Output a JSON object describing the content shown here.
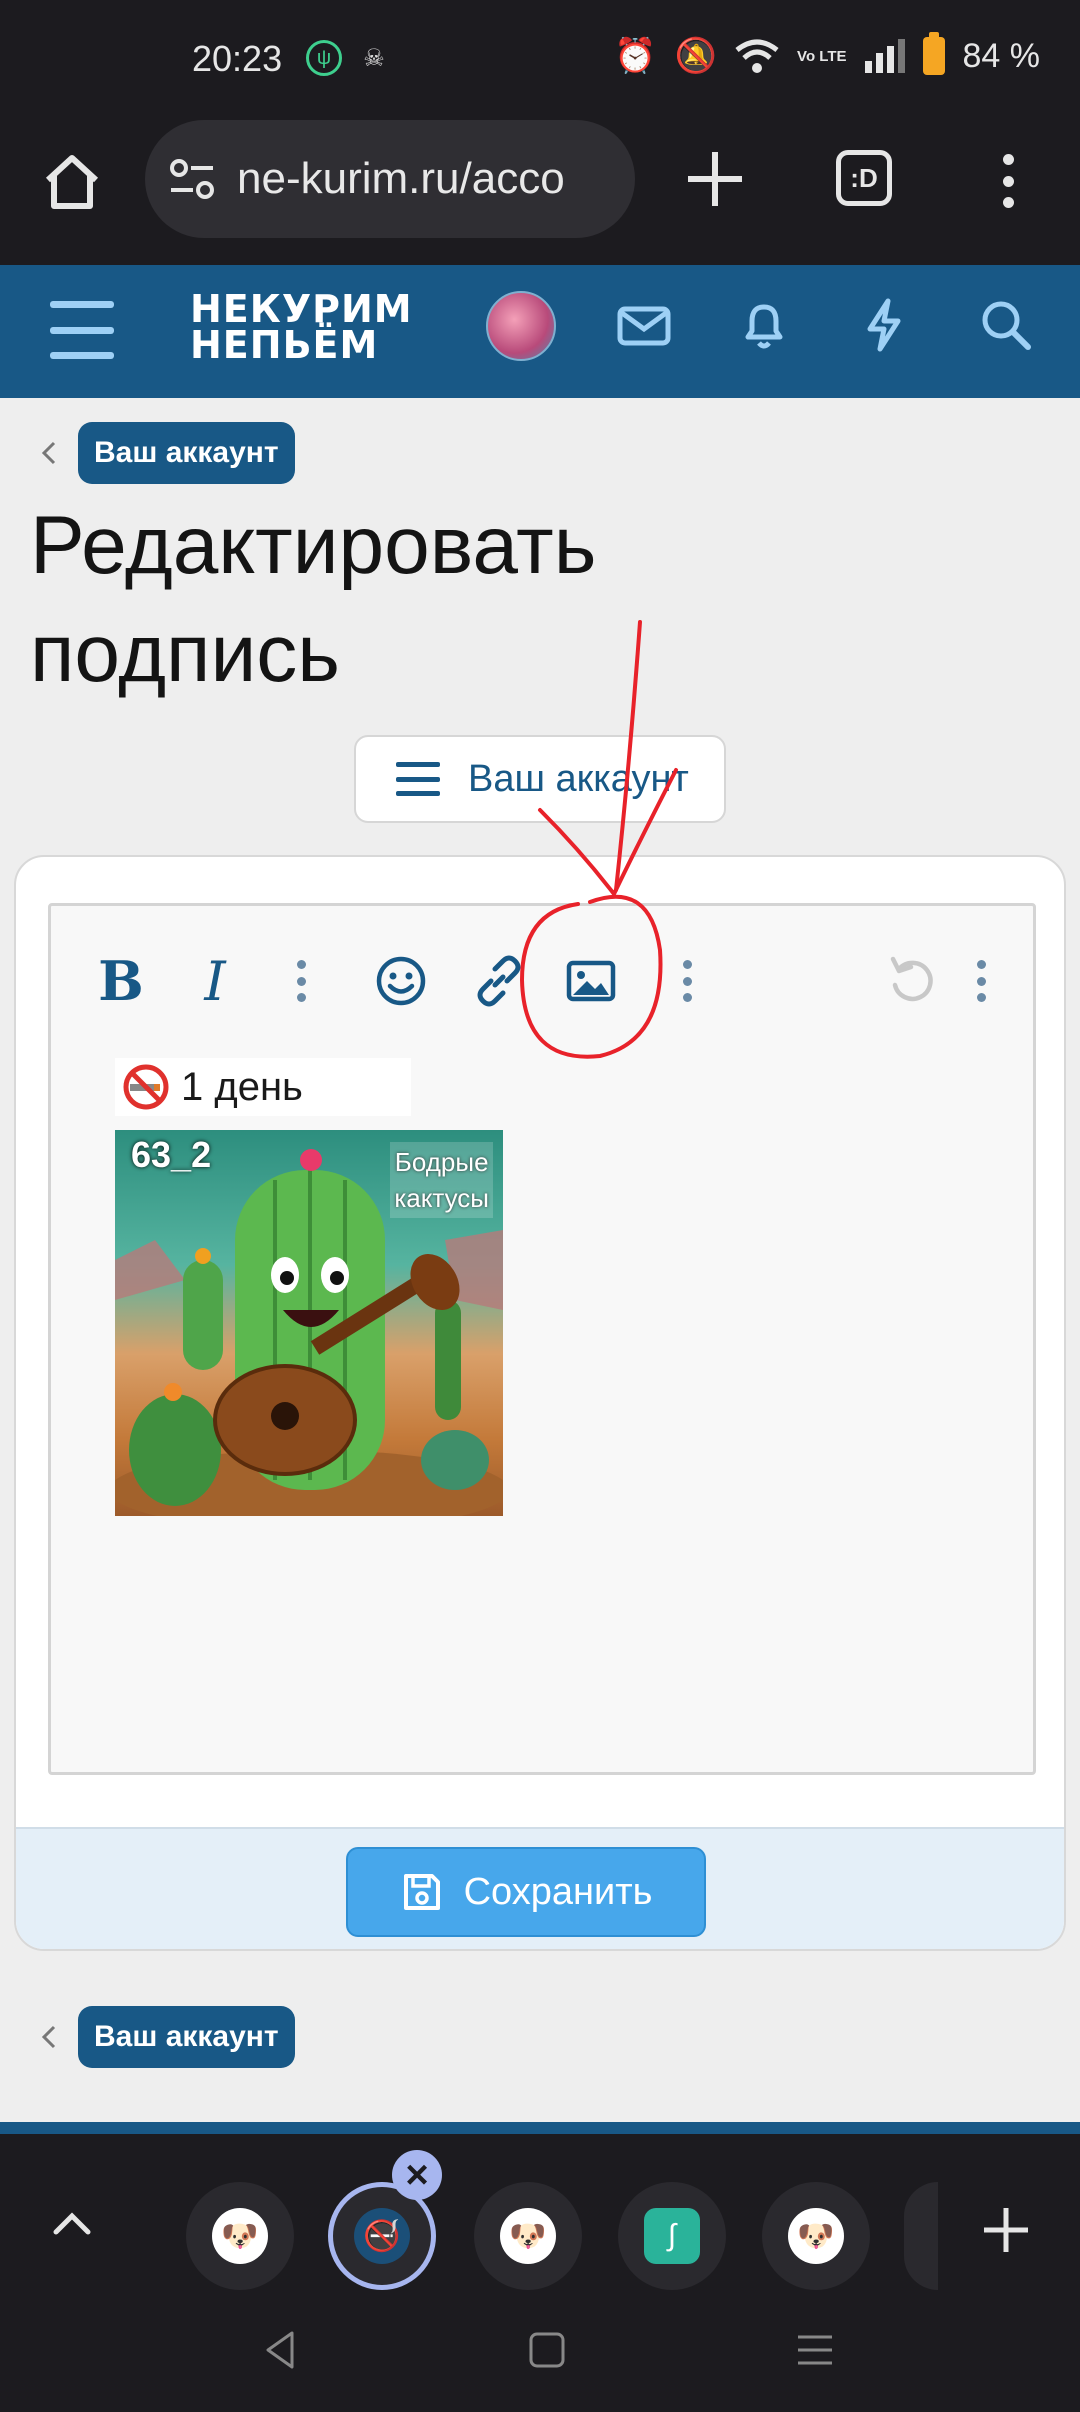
{
  "status_bar": {
    "time": "20:23",
    "battery": "84 %",
    "network": "Vo LTE"
  },
  "browser": {
    "url": "ne-kurim.ru/acco",
    "tabs_icon_text": ":D"
  },
  "site_header": {
    "logo_line1": "НЕКУРИМ",
    "logo_line2": "НЕПЬЁМ"
  },
  "breadcrumb_top": {
    "label": "Ваш аккаунт"
  },
  "page": {
    "title_line1": "Редактировать",
    "title_line2": "подпись"
  },
  "account_menu": {
    "label": "Ваш аккаунт"
  },
  "editor": {
    "toolbar": {
      "bold": "B",
      "italic": "I"
    },
    "signature_text": "1 день",
    "image": {
      "number": "63_2",
      "tag_line1": "Бодрые",
      "tag_line2": "кактусы"
    }
  },
  "save": {
    "label": "Сохранить"
  },
  "breadcrumb_bottom": {
    "label": "Ваш аккаунт"
  },
  "colors": {
    "brand": "#185886",
    "button": "#47a7eb",
    "annotation": "#e8222a"
  }
}
